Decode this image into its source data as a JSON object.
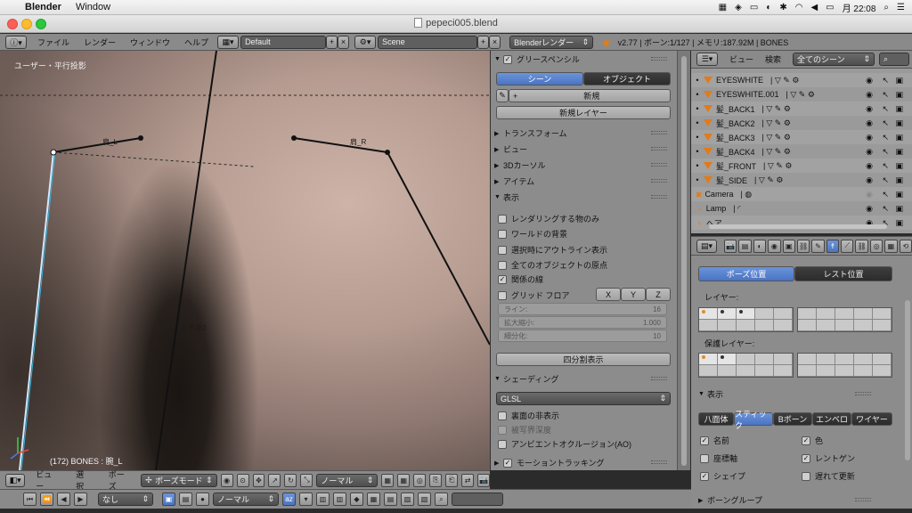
{
  "macos": {
    "app_name": "Blender",
    "menu": [
      "Window"
    ],
    "clock": "月 22:08"
  },
  "window": {
    "title": "pepeci005.blend"
  },
  "info_header": {
    "menus": [
      "ファイル",
      "レンダー",
      "ウィンドウ",
      "ヘルプ"
    ],
    "screen_layout": "Default",
    "scene": "Scene",
    "render_engine": "Blenderレンダー",
    "stats": "v2.77 | ボーン:1/127 | メモリ:187.92M | BONES"
  },
  "viewport": {
    "view_label": "ユーザー・平行投影",
    "status": "(172) BONES : 腕_L",
    "bone_labels": [
      "肩_L",
      "上半身2",
      "肩_R"
    ]
  },
  "npanel": {
    "grease_pencil": "グリースペンシル",
    "gp_tabs": [
      "シーン",
      "オブジェクト"
    ],
    "new": "新規",
    "new_layer": "新規レイヤー",
    "sections": [
      "トランスフォーム",
      "ビュー",
      "3Dカーソル",
      "アイテム"
    ],
    "display": "表示",
    "display_options": [
      {
        "label": "レンダリングする物のみ",
        "checked": false
      },
      {
        "label": "ワールドの背景",
        "checked": false
      },
      {
        "label": "選択時にアウトライン表示",
        "checked": false
      },
      {
        "label": "全てのオブジェクトの原点",
        "checked": false
      },
      {
        "label": "関係の線",
        "checked": true
      }
    ],
    "grid_floor": "グリッド フロア",
    "axes": [
      "X",
      "Y",
      "Z"
    ],
    "fields": [
      {
        "label": "ライン:",
        "value": "16"
      },
      {
        "label": "拡大縮小:",
        "value": "1.000"
      },
      {
        "label": "細分化:",
        "value": "10"
      }
    ],
    "quad_view": "四分割表示",
    "shading": "シェーディング",
    "shading_mode": "GLSL",
    "shading_options": [
      {
        "label": "裏面の非表示",
        "checked": false,
        "disabled": false
      },
      {
        "label": "被写界深度",
        "checked": false,
        "disabled": true
      },
      {
        "label": "アンビエントオクルージョン(AO)",
        "checked": false,
        "disabled": false
      }
    ],
    "motion_tracking": "モーショントラッキング"
  },
  "viewport_footer": {
    "menus": [
      "ビュー",
      "選択",
      "ポーズ"
    ],
    "mode": "ポーズモード",
    "orientation": "ノーマル"
  },
  "timeline_footer": {
    "keying": "なし",
    "orientation": "ノーマル"
  },
  "outliner": {
    "view": "ビュー",
    "search": "検索",
    "filter": "全てのシーン",
    "items": [
      {
        "name": "EYESWHITE",
        "kind": "mesh"
      },
      {
        "name": "EYESWHITE.001",
        "kind": "mesh"
      },
      {
        "name": "髪_BACK1",
        "kind": "mesh"
      },
      {
        "name": "髪_BACK2",
        "kind": "mesh"
      },
      {
        "name": "髪_BACK3",
        "kind": "mesh"
      },
      {
        "name": "髪_BACK4",
        "kind": "mesh"
      },
      {
        "name": "髪_FRONT",
        "kind": "mesh"
      },
      {
        "name": "髪_SIDE",
        "kind": "mesh"
      },
      {
        "name": "Camera",
        "kind": "camera"
      },
      {
        "name": "Lamp",
        "kind": "lamp"
      },
      {
        "name": "ヘア",
        "kind": "lamp"
      }
    ]
  },
  "properties": {
    "pose_tabs": [
      "ポーズ位置",
      "レスト位置"
    ],
    "layer_label": "レイヤー:",
    "protect_label": "保護レイヤー:",
    "display": "表示",
    "display_types": [
      "八面体",
      "スティック",
      "Bボーン",
      "エンベロ",
      "ワイヤー"
    ],
    "display_options": [
      {
        "label": "名前",
        "checked": true
      },
      {
        "label": "色",
        "checked": true
      },
      {
        "label": "座標軸",
        "checked": false
      },
      {
        "label": "レントゲン",
        "checked": true
      },
      {
        "label": "シェイプ",
        "checked": true
      },
      {
        "label": "遅れて更新",
        "checked": false
      }
    ],
    "bone_groups": "ボーングループ"
  },
  "colors": {
    "accent": "#5680cc",
    "outliner_mesh_icon": "#e07b1a"
  }
}
